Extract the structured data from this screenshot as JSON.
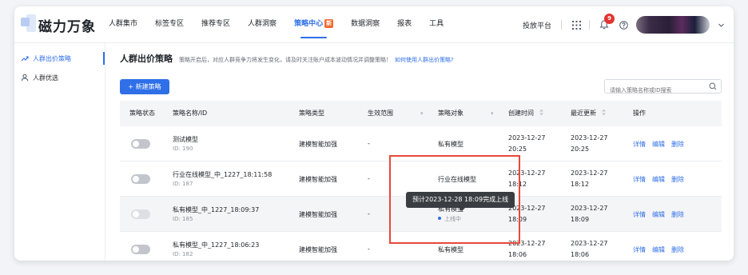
{
  "app": {
    "logo_text": "磁力万象"
  },
  "nav": {
    "items": [
      {
        "label": "人群集市",
        "active": false
      },
      {
        "label": "标签专区",
        "active": false
      },
      {
        "label": "推荐专区",
        "active": false
      },
      {
        "label": "人群洞察",
        "active": false
      },
      {
        "label": "策略中心",
        "active": true,
        "badge": "新"
      },
      {
        "label": "数据洞察",
        "active": false
      },
      {
        "label": "报表",
        "active": false
      },
      {
        "label": "工具",
        "active": false
      }
    ],
    "right_link": "投放平台",
    "notification_count": "9"
  },
  "sidebar": {
    "items": [
      {
        "label": "人群出价策略",
        "icon": "trend-icon",
        "active": true
      },
      {
        "label": "人群优选",
        "icon": "people-icon",
        "active": false
      }
    ]
  },
  "page": {
    "title": "人群出价策略",
    "description": "策略开启后，对应人群竞争力将发生变化，请及时关注账户成本波动情况并调整策略！",
    "help_link": "如何使用人群出价策略?",
    "new_button": "+ 新建策略",
    "search_placeholder": "请输入策略名称或ID搜索"
  },
  "table": {
    "headers": {
      "status": "策略状态",
      "name": "策略名称/ID",
      "type": "策略类型",
      "scope": "生效范围",
      "object": "策略对象",
      "created": "创建时间",
      "updated": "最近更新",
      "ops": "操作"
    },
    "rows": [
      {
        "name": "测试模型",
        "id": "ID: 190",
        "type": "建模智能加强",
        "scope": "-",
        "object": "私有模型",
        "object_status": "",
        "created_date": "2023-12-27",
        "created_time": "20:25",
        "updated_date": "2023-12-27",
        "updated_time": "20:25",
        "enabled": false
      },
      {
        "name": "行业在线模型_中_1227_18:11:58",
        "id": "ID: 187",
        "type": "建模智能加强",
        "scope": "-",
        "object": "行业在线模型",
        "object_status": "",
        "created_date": "2023-12-27",
        "created_time": "18:12",
        "updated_date": "2023-12-27",
        "updated_time": "18:12",
        "enabled": false
      },
      {
        "name": "私有模型_中_1227_18:09:37",
        "id": "ID: 185",
        "type": "建模智能加强",
        "scope": "-",
        "object": "私有模型",
        "object_status": "上线中",
        "created_date": "2023-12-27",
        "created_time": "18:09",
        "updated_date": "2023-12-27",
        "updated_time": "18:09",
        "enabled": false
      },
      {
        "name": "私有模型_中_1227_18:06:23",
        "id": "ID: 182",
        "type": "建模智能加强",
        "scope": "-",
        "object": "私有模型",
        "object_status": "",
        "created_date": "2023-12-27",
        "created_time": "18:06",
        "updated_date": "2023-12-27",
        "updated_time": "18:06",
        "enabled": false
      }
    ],
    "actions": {
      "detail": "详情",
      "edit": "编辑",
      "delete": "删除"
    }
  },
  "tooltip": {
    "text": "预计2023-12-28 18:09完成上线"
  },
  "colors": {
    "primary": "#2f6fe8",
    "highlight": "#e8483b",
    "badge": "#f46a2d"
  }
}
